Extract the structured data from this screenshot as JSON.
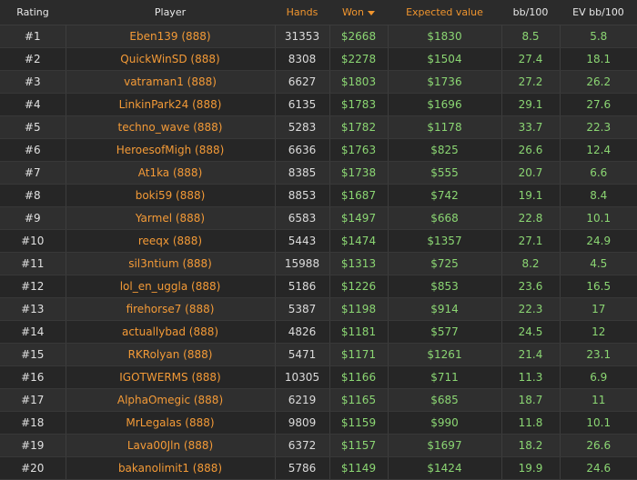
{
  "headers": {
    "rating": "Rating",
    "player": "Player",
    "hands": "Hands",
    "won": "Won",
    "expected": "Expected value",
    "bb100": "bb/100",
    "evbb100": "EV bb/100"
  },
  "rows": [
    {
      "rank": "#1",
      "player": "Eben139 (888)",
      "hands": "31353",
      "won": "$2668",
      "ev": "$1830",
      "bb": "8.5",
      "evbb": "5.8"
    },
    {
      "rank": "#2",
      "player": "QuickWinSD (888)",
      "hands": "8308",
      "won": "$2278",
      "ev": "$1504",
      "bb": "27.4",
      "evbb": "18.1"
    },
    {
      "rank": "#3",
      "player": "vatraman1 (888)",
      "hands": "6627",
      "won": "$1803",
      "ev": "$1736",
      "bb": "27.2",
      "evbb": "26.2"
    },
    {
      "rank": "#4",
      "player": "LinkinPark24 (888)",
      "hands": "6135",
      "won": "$1783",
      "ev": "$1696",
      "bb": "29.1",
      "evbb": "27.6"
    },
    {
      "rank": "#5",
      "player": "techno_wave (888)",
      "hands": "5283",
      "won": "$1782",
      "ev": "$1178",
      "bb": "33.7",
      "evbb": "22.3"
    },
    {
      "rank": "#6",
      "player": "HeroesofMigh (888)",
      "hands": "6636",
      "won": "$1763",
      "ev": "$825",
      "bb": "26.6",
      "evbb": "12.4"
    },
    {
      "rank": "#7",
      "player": "At1ka (888)",
      "hands": "8385",
      "won": "$1738",
      "ev": "$555",
      "bb": "20.7",
      "evbb": "6.6"
    },
    {
      "rank": "#8",
      "player": "boki59 (888)",
      "hands": "8853",
      "won": "$1687",
      "ev": "$742",
      "bb": "19.1",
      "evbb": "8.4"
    },
    {
      "rank": "#9",
      "player": "Yarmel (888)",
      "hands": "6583",
      "won": "$1497",
      "ev": "$668",
      "bb": "22.8",
      "evbb": "10.1"
    },
    {
      "rank": "#10",
      "player": "reeqx (888)",
      "hands": "5443",
      "won": "$1474",
      "ev": "$1357",
      "bb": "27.1",
      "evbb": "24.9"
    },
    {
      "rank": "#11",
      "player": "sil3ntium (888)",
      "hands": "15988",
      "won": "$1313",
      "ev": "$725",
      "bb": "8.2",
      "evbb": "4.5"
    },
    {
      "rank": "#12",
      "player": "lol_en_uggla (888)",
      "hands": "5186",
      "won": "$1226",
      "ev": "$853",
      "bb": "23.6",
      "evbb": "16.5"
    },
    {
      "rank": "#13",
      "player": "firehorse7 (888)",
      "hands": "5387",
      "won": "$1198",
      "ev": "$914",
      "bb": "22.3",
      "evbb": "17"
    },
    {
      "rank": "#14",
      "player": "actuallybad (888)",
      "hands": "4826",
      "won": "$1181",
      "ev": "$577",
      "bb": "24.5",
      "evbb": "12"
    },
    {
      "rank": "#15",
      "player": "RKRolyan (888)",
      "hands": "5471",
      "won": "$1171",
      "ev": "$1261",
      "bb": "21.4",
      "evbb": "23.1"
    },
    {
      "rank": "#16",
      "player": "IGOTWERMS (888)",
      "hands": "10305",
      "won": "$1166",
      "ev": "$711",
      "bb": "11.3",
      "evbb": "6.9"
    },
    {
      "rank": "#17",
      "player": "AlphaOmegic (888)",
      "hands": "6219",
      "won": "$1165",
      "ev": "$685",
      "bb": "18.7",
      "evbb": "11"
    },
    {
      "rank": "#18",
      "player": "MrLegalas (888)",
      "hands": "9809",
      "won": "$1159",
      "ev": "$990",
      "bb": "11.8",
      "evbb": "10.1"
    },
    {
      "rank": "#19",
      "player": "Lava00Jln (888)",
      "hands": "6372",
      "won": "$1157",
      "ev": "$1697",
      "bb": "18.2",
      "evbb": "26.6"
    },
    {
      "rank": "#20",
      "player": "bakanolimit1 (888)",
      "hands": "5786",
      "won": "$1149",
      "ev": "$1424",
      "bb": "19.9",
      "evbb": "24.6"
    }
  ],
  "colors": {
    "accent_orange": "#f0952e",
    "positive_green": "#8bd673",
    "background": "#2b2b2b"
  }
}
